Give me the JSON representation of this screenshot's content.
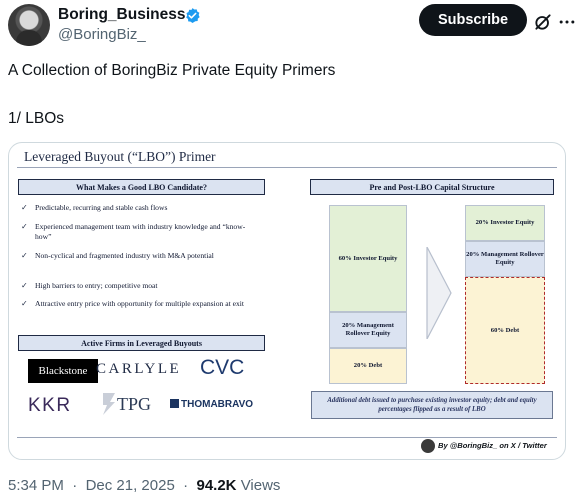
{
  "header": {
    "display_name": "Boring_Business",
    "handle": "@BoringBiz_",
    "subscribe_label": "Subscribe",
    "icons": [
      "verified-badge-icon",
      "grok-icon",
      "more-icon"
    ],
    "colors": {
      "verified": "#1d9bf0",
      "subscribe_bg": "#0f1419"
    }
  },
  "tweet": {
    "line1": "A Collection of BoringBiz Private Equity Primers",
    "line2": "1/ LBOs"
  },
  "slide": {
    "title": "Leveraged Buyout (“LBO”) Primer",
    "candidate_header": "What Makes a Good LBO Candidate?",
    "criteria": [
      "Predictable, recurring and stable cash flows",
      "Experienced management team with industry knowledge and “know-how”",
      "Non-cyclical and fragmented industry with M&A potential",
      "High barriers to entry; competitive moat",
      "Attractive entry price with opportunity for multiple expansion at exit"
    ],
    "firms_header": "Active Firms in Leveraged Buyouts",
    "firms": [
      "Blackstone",
      "CARLYLE",
      "CVC",
      "KKR",
      "TPG",
      "THOMABRAVO"
    ],
    "capital_header": "Pre and Post-LBO Capital Structure",
    "pre_lbo": [
      {
        "label": "60% Investor Equity",
        "percent": 60,
        "color": "#e3f0d6"
      },
      {
        "label": "20% Management Rollover Equity",
        "percent": 20,
        "color": "#dbe3f1"
      },
      {
        "label": "20% Debt",
        "percent": 20,
        "color": "#fcf3d4"
      }
    ],
    "post_lbo": [
      {
        "label": "20% Investor Equity",
        "percent": 20,
        "color": "#e3f0d6"
      },
      {
        "label": "20% Management Rollover Equity",
        "percent": 20,
        "color": "#dbe3f1"
      },
      {
        "label": "60% Debt",
        "percent": 60,
        "color": "#fcf3d4"
      }
    ],
    "note": "Additional debt issued to purchase existing investor equity; debt and equity percentages flipped as a result of LBO",
    "credit": "By @BoringBiz_ on X / Twitter"
  },
  "meta": {
    "time": "5:34 PM",
    "date": "Dec 21, 2025",
    "views_count": "94.2K",
    "views_label": "Views"
  }
}
